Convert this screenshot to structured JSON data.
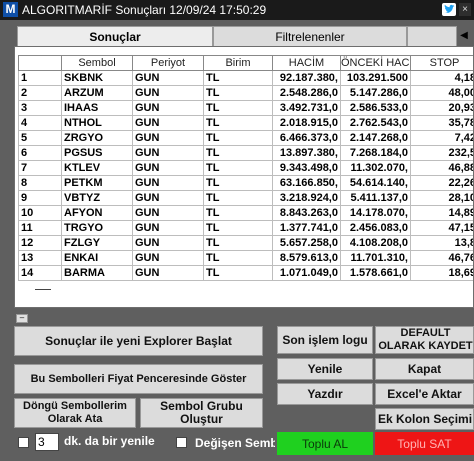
{
  "window": {
    "title": "ALGORITMARİF Sonuçları 12/09/24 17:50:29",
    "logo_letter": "M",
    "close_label": "×"
  },
  "tabs": {
    "results": "Sonuçlar",
    "filtered": "Filtrelenenler",
    "scroll_arrow": "◀"
  },
  "table": {
    "columns": [
      "",
      "Sembol",
      "Periyot",
      "Birim",
      "HACİM",
      "ÖNCEKİ HACİ",
      "STOP"
    ],
    "rows": [
      [
        "1",
        "SKBNK",
        "GUN",
        "TL",
        "92.187.380,",
        "103.291.500",
        "4,18"
      ],
      [
        "2",
        "ARZUM",
        "GUN",
        "TL",
        "2.548.286,0",
        "5.147.286,0",
        "48,00"
      ],
      [
        "3",
        "IHAAS",
        "GUN",
        "TL",
        "3.492.731,0",
        "2.586.533,0",
        "20,93"
      ],
      [
        "4",
        "NTHOL",
        "GUN",
        "TL",
        "2.018.915,0",
        "2.762.543,0",
        "35,78"
      ],
      [
        "5",
        "ZRGYO",
        "GUN",
        "TL",
        "6.466.373,0",
        "2.147.268,0",
        "7,42"
      ],
      [
        "6",
        "PGSUS",
        "GUN",
        "TL",
        "13.897.380,",
        "7.268.184,0",
        "232,5"
      ],
      [
        "7",
        "KTLEV",
        "GUN",
        "TL",
        "9.343.498,0",
        "11.302.070,",
        "46,88"
      ],
      [
        "8",
        "PETKM",
        "GUN",
        "TL",
        "63.166.850,",
        "54.614.140,",
        "22,26"
      ],
      [
        "9",
        "VBTYZ",
        "GUN",
        "TL",
        "3.218.924,0",
        "5.411.137,0",
        "28,10"
      ],
      [
        "10",
        "AFYON",
        "GUN",
        "TL",
        "8.843.263,0",
        "14.178.070,",
        "14,89"
      ],
      [
        "11",
        "TRGYO",
        "GUN",
        "TL",
        "1.377.741,0",
        "2.456.083,0",
        "47,15"
      ],
      [
        "12",
        "FZLGY",
        "GUN",
        "TL",
        "5.657.258,0",
        "4.108.208,0",
        "13,8"
      ],
      [
        "13",
        "ENKAI",
        "GUN",
        "TL",
        "8.579.613,0",
        "11.701.310,",
        "46,76"
      ],
      [
        "14",
        "BARMA",
        "GUN",
        "TL",
        "1.071.049,0",
        "1.578.661,0",
        "18,69"
      ]
    ]
  },
  "buttons": {
    "new_explorer": "Sonuçlar ile yeni Explorer Başlat",
    "show_in_price": "Bu Sembolleri Fiyat Penceresinde Göster",
    "loop_symbols": "Döngü Sembollerim Olarak Ata",
    "symbol_group": "Sembol Grubu Oluştur",
    "last_log": "Son işlem logu",
    "default_save": "DEFAULT OLARAK KAYDET",
    "refresh": "Yenile",
    "close": "Kapat",
    "print": "Yazdır",
    "excel": "Excel'e Aktar",
    "extra_column": "Ek Kolon Seçimi",
    "buy_all": "Toplu AL",
    "sell_all": "Toplu SAT"
  },
  "footer": {
    "interval_value": "3",
    "interval_label": "dk. da bir yenile",
    "changing_label": "Değişen Semb"
  },
  "colors": {
    "buy": "#1fd01f",
    "sell": "#ee1515",
    "background": "#5f5f5f"
  }
}
